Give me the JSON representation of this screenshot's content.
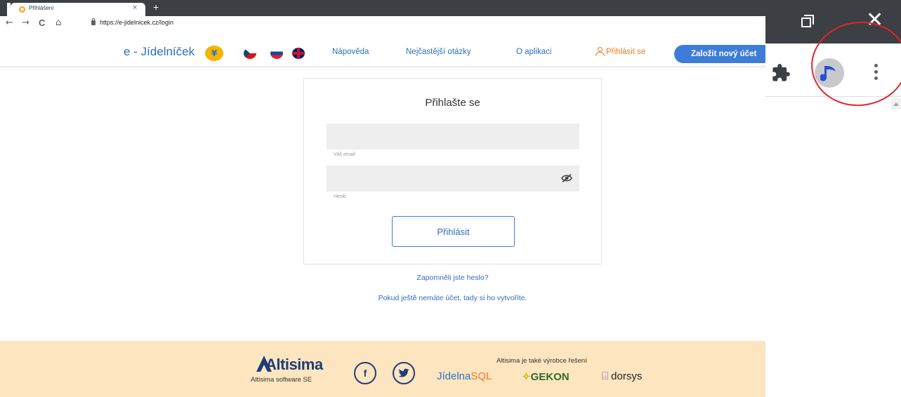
{
  "browser": {
    "tab_title": "Přihlášení",
    "tab_close": "×",
    "new_tab": "+",
    "url": "https://e-jidelnicek.cz/login",
    "nav_back": "←",
    "nav_forward": "→",
    "nav_reload": "C",
    "nav_home": "⌂"
  },
  "header": {
    "logo": "e - Jídelníček",
    "nav": [
      "Nápověda",
      "Nejčastější otázky",
      "O aplikaci"
    ],
    "login": "Přihlásit se",
    "signup": "Založit nový účet"
  },
  "login_form": {
    "title": "Přihlašte se",
    "email_label": "Váš email",
    "password_label": "Heslo",
    "submit": "Přihlásit",
    "forgot": "Zapomněli jste heslo?",
    "register": "Pokud ještě nemáte účet, tady si ho vytvoříte."
  },
  "footer": {
    "brand": "Altisima",
    "brand_sub": "Altisima software SE",
    "social": [
      "f",
      "t"
    ],
    "partner_note": "Altisima je také výrobce řešení",
    "partners": {
      "jidelna_a": "Jídelna",
      "jidelna_b": "SQL",
      "gekon": "GEKON",
      "dorsys": "dorsys"
    }
  },
  "ext_panel": {
    "close": "✕"
  },
  "colors": {
    "brand_blue": "#2e6fbf",
    "accent_orange": "#f07c1f",
    "footer_bg": "#fde5c0",
    "highlight_circle": "#e0252b"
  }
}
